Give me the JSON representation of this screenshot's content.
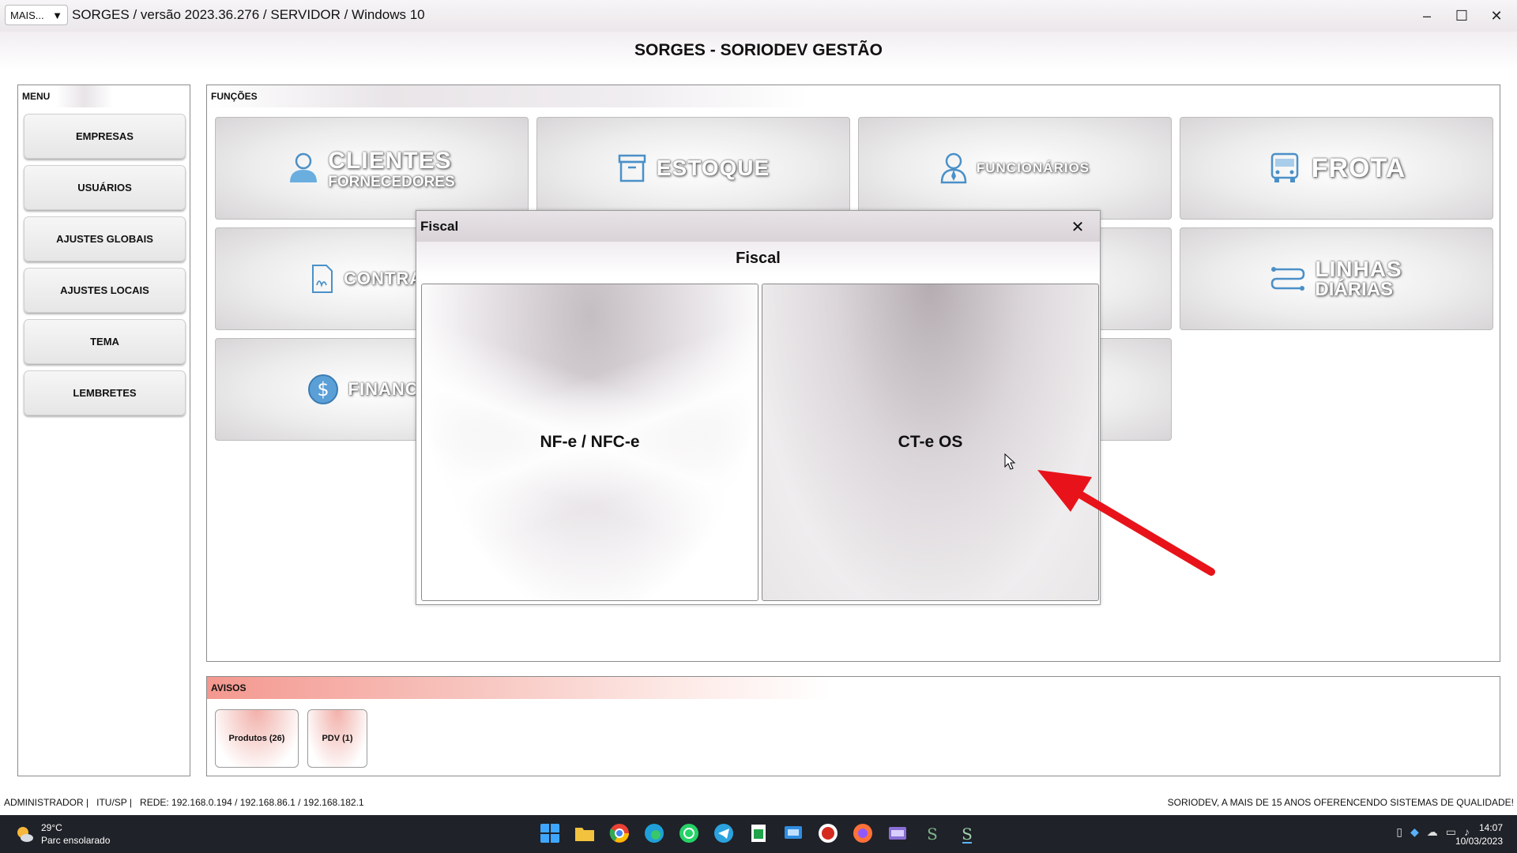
{
  "window": {
    "mais_label": "MAIS...",
    "title": "SORGES / versão 2023.36.276 / SERVIDOR / Windows 10",
    "minimize": "–",
    "maximize": "☐",
    "close": "✕"
  },
  "header": {
    "title": "SORGES - SORIODEV GESTÃO"
  },
  "menu": {
    "title": "MENU",
    "items": [
      {
        "label": "EMPRESAS"
      },
      {
        "label": "USUÁRIOS"
      },
      {
        "label": "AJUSTES GLOBAIS"
      },
      {
        "label": "AJUSTES LOCAIS"
      },
      {
        "label": "TEMA"
      },
      {
        "label": "LEMBRETES"
      }
    ]
  },
  "funcoes": {
    "title": "FUNÇÕES",
    "tiles": {
      "clientes": {
        "label": "CLIENTES",
        "sub": "FORNECEDORES",
        "icon": "person-icon"
      },
      "estoque": {
        "label": "ESTOQUE",
        "icon": "box-icon"
      },
      "funcionarios": {
        "label": "FUNCIONÁRIOS",
        "icon": "employee-icon"
      },
      "frota": {
        "label": "FROTA",
        "icon": "bus-icon"
      },
      "contratos": {
        "label": "CONTRAT",
        "icon": "contract-icon"
      },
      "linhas": {
        "label": "LINHAS",
        "sub": "DIÁRIAS",
        "icon": "route-icon"
      },
      "financeiro": {
        "label": "FINANCEI",
        "icon": "dollar-icon"
      }
    }
  },
  "avisos": {
    "title": "AVISOS",
    "items": [
      {
        "label": "Produtos (26)"
      },
      {
        "label": "PDV (1)"
      }
    ]
  },
  "modal": {
    "title": "Fiscal",
    "header": "Fiscal",
    "close": "✕",
    "options": [
      {
        "label": "NF-e / NFC-e"
      },
      {
        "label": "CT-e OS"
      }
    ]
  },
  "status": {
    "left": "ADMINISTRADOR |   ITU/SP |   REDE: 192.168.0.194 / 192.168.86.1 / 192.168.182.1",
    "right": "SORIODEV, A MAIS DE 15 ANOS OFERENCENDO SISTEMAS DE QUALIDADE!"
  },
  "taskbar": {
    "temp": "29°C",
    "weather": "Parc ensolarado",
    "time": "14:07",
    "date": "10/03/2023"
  },
  "colors": {
    "annotation_arrow": "#e8131a",
    "tile_icon": "#4a90c8",
    "avisos_accent": "#f4988f"
  }
}
